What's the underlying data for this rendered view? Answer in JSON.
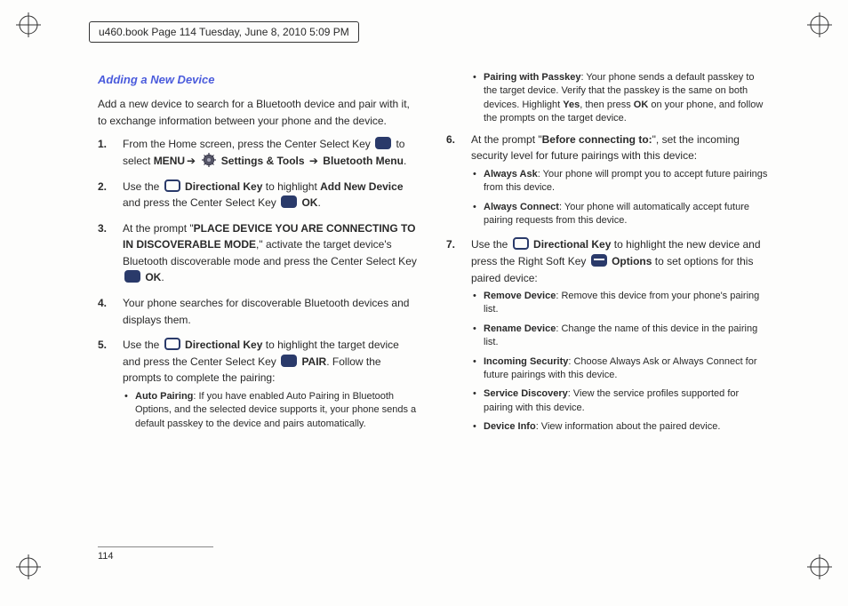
{
  "header": "u460.book  Page 114  Tuesday, June 8, 2010  5:09 PM",
  "section_title": "Adding a New Device",
  "intro": "Add a new device to search for a Bluetooth device and pair with it, to exchange information between your phone and the device.",
  "step1_a": "From the Home screen, press the Center Select Key ",
  "step1_b": " to select ",
  "step1_menu": "MENU",
  "step1_c": " ",
  "step1_settings": " Settings & Tools ",
  "step1_bt": " Bluetooth Menu",
  "step1_d": ".",
  "step2_a": "Use the ",
  "step2_dir": " Directional Key",
  "step2_b": " to highlight ",
  "step2_add": "Add New Device",
  "step2_c": " and press the Center Select Key ",
  "step2_ok": " OK",
  "step2_d": ".",
  "step3_a": "At the prompt \"",
  "step3_prompt": "PLACE DEVICE YOU ARE CONNECTING TO IN DISCOVERABLE MODE",
  "step3_b": ",\" activate the target device's Bluetooth discoverable mode and press the Center Select Key ",
  "step3_ok": " OK",
  "step3_c": ".",
  "step4": "Your phone searches for discoverable Bluetooth devices and displays them.",
  "step5_a": "Use the ",
  "step5_dir": " Directional Key",
  "step5_b": " to highlight the target device and press the Center Select Key ",
  "step5_pair": " PAIR",
  "step5_c": ".  Follow the prompts to complete the pairing:",
  "sub_auto_t": "Auto Pairing",
  "sub_auto_d": ": If you have enabled Auto Pairing in Bluetooth Options, and the selected device supports it, your phone sends a default passkey to the device and pairs automatically.",
  "sub_pass_t": "Pairing with Passkey",
  "sub_pass_d": ": Your phone sends a default passkey to the target device. Verify that the passkey is the same on both devices. Highlight ",
  "sub_pass_yes": "Yes",
  "sub_pass_d2": ", then press ",
  "sub_pass_ok": "OK",
  "sub_pass_d3": " on your phone, and follow the prompts on the target device.",
  "step6_a": "At the prompt \"",
  "step6_prompt": "Before connecting to:",
  "step6_b": "\", set the incoming security level for future pairings with this device:",
  "sub_ask_t": "Always Ask",
  "sub_ask_d": ": Your phone will prompt you to accept future pairings from this device.",
  "sub_conn_t": "Always Connect",
  "sub_conn_d": ": Your phone will automatically accept future pairing requests from this device.",
  "step7_a": "Use the ",
  "step7_dir": " Directional Key",
  "step7_b": " to highlight the new device and press the Right Soft Key ",
  "step7_opt": " Options",
  "step7_c": " to set options for this paired device:",
  "sub_rem_t": "Remove Device",
  "sub_rem_d": ": Remove this device from your phone's pairing list.",
  "sub_ren_t": "Rename Device",
  "sub_ren_d": ": Change the name of this device in the pairing list.",
  "sub_inc_t": "Incoming Security",
  "sub_inc_d": ": Choose Always Ask or Always Connect for future pairings with this device.",
  "sub_srv_t": "Service Discovery",
  "sub_srv_d": ": View the service profiles supported for pairing with this device.",
  "sub_inf_t": "Device Info",
  "sub_inf_d": ": View information about the paired device.",
  "pagenum": "114",
  "nums": {
    "n1": "1.",
    "n2": "2.",
    "n3": "3.",
    "n4": "4.",
    "n5": "5.",
    "n6": "6.",
    "n7": "7."
  },
  "arrow": "➔"
}
